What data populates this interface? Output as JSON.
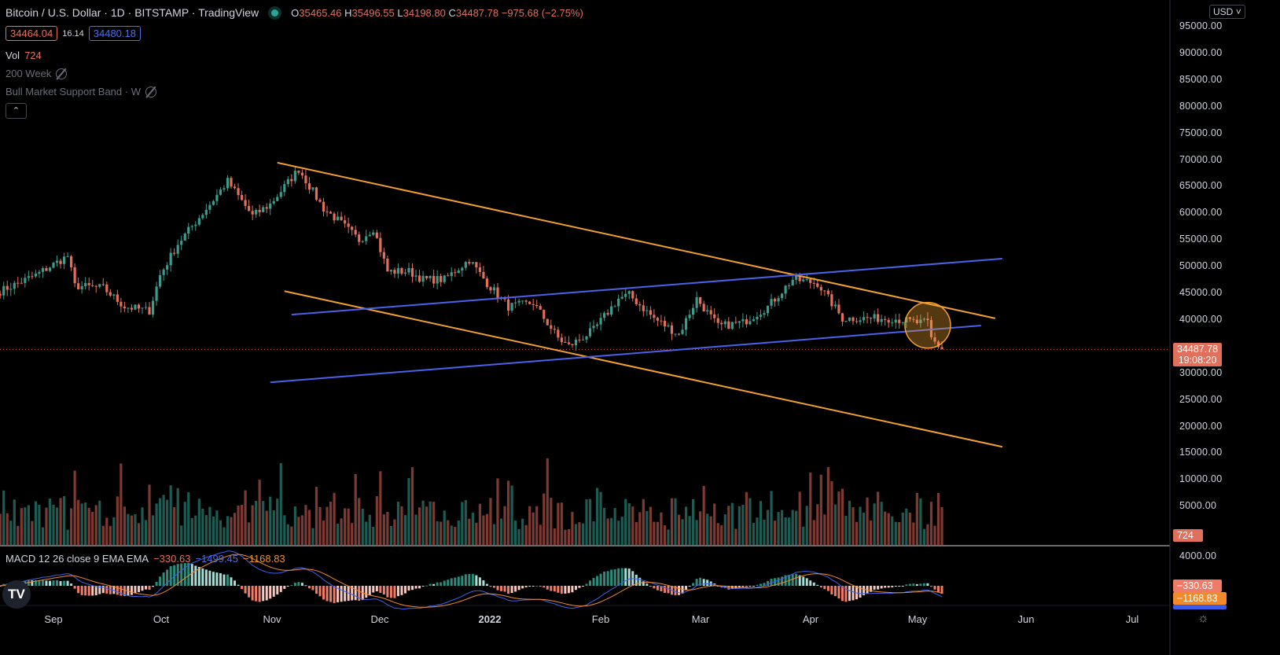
{
  "header": {
    "symbol": "Bitcoin / U.S. Dollar",
    "interval": "1D",
    "exchange": "BITSTAMP",
    "source": "TradingView",
    "market_status_color": "#26a69a",
    "o_label": "O",
    "open": "35465.46",
    "h_label": "H",
    "high": "35496.55",
    "l_label": "L",
    "low": "34198.80",
    "c_label": "C",
    "close": "34487.78",
    "change": "−975.68 (−2.75%)",
    "bid": "34464.04",
    "spread": "16.14",
    "ask": "34480.18"
  },
  "indicators": {
    "vol_label": "Vol",
    "vol_value": "724",
    "ma200": "200 Week",
    "bmsb": "Bull Market Support Band · W",
    "collapse_icon": "chevron-up-icon",
    "hidden_icon": "eye-off-icon"
  },
  "macd": {
    "label": "MACD 12 26 close 9 EMA EMA",
    "hist": "−330.63",
    "macd": "−1499.45",
    "signal": "−1168.83"
  },
  "currency": "USD",
  "price_axis": [
    "95000.00",
    "90000.00",
    "85000.00",
    "80000.00",
    "75000.00",
    "70000.00",
    "65000.00",
    "60000.00",
    "55000.00",
    "50000.00",
    "45000.00",
    "40000.00",
    "30000.00",
    "25000.00",
    "20000.00",
    "15000.00",
    "10000.00",
    "5000.00"
  ],
  "last_price": {
    "price": "34487.78",
    "countdown": "19:08:20",
    "vol": "724"
  },
  "macd_axis": {
    "tick": "4000.00",
    "hist": "−330.63",
    "signal": "−1168.83",
    "macd": "−1499.45"
  },
  "time_axis": [
    "Sep",
    "Oct",
    "Nov",
    "Dec",
    "2022",
    "Feb",
    "Mar",
    "Apr",
    "May",
    "Jun",
    "Jul"
  ],
  "colors": {
    "up": "#3b9c8c",
    "down": "#e0705c",
    "vol_up": "#1e5b52",
    "vol_down": "#7c3a32",
    "orange_line": "#f0a030",
    "blue_line": "#4a62e8",
    "circle": "#f0a030"
  },
  "chart_data": {
    "type": "candlestick",
    "symbol": "BTCUSD",
    "interval": "1D",
    "ylim": [
      0,
      97000
    ],
    "approx_closes": [
      [
        "2021-08-17",
        45400
      ],
      [
        "2021-08-27",
        48400
      ],
      [
        "2021-09-05",
        52000
      ],
      [
        "2021-09-07",
        46400
      ],
      [
        "2021-09-15",
        46000
      ],
      [
        "2021-09-21",
        42500
      ],
      [
        "2021-09-28",
        41700
      ],
      [
        "2021-10-01",
        48400
      ],
      [
        "2021-10-06",
        54300
      ],
      [
        "2021-10-15",
        61700
      ],
      [
        "2021-10-20",
        66000
      ],
      [
        "2021-10-27",
        59500
      ],
      [
        "2021-11-01",
        61700
      ],
      [
        "2021-11-09",
        68300
      ],
      [
        "2021-11-16",
        60900
      ],
      [
        "2021-11-20",
        58700
      ],
      [
        "2021-11-26",
        55000
      ],
      [
        "2021-11-30",
        57200
      ],
      [
        "2021-12-04",
        49100
      ],
      [
        "2021-12-10",
        49100
      ],
      [
        "2021-12-14",
        47600
      ],
      [
        "2021-12-20",
        47600
      ],
      [
        "2021-12-27",
        51300
      ],
      [
        "2022-01-01",
        46900
      ],
      [
        "2022-01-07",
        42500
      ],
      [
        "2022-01-14",
        43200
      ],
      [
        "2022-01-21",
        36600
      ],
      [
        "2022-01-24",
        35100
      ],
      [
        "2022-01-31",
        38100
      ],
      [
        "2022-02-07",
        44000
      ],
      [
        "2022-02-10",
        44700
      ],
      [
        "2022-02-17",
        40300
      ],
      [
        "2022-02-24",
        37300
      ],
      [
        "2022-03-01",
        44000
      ],
      [
        "2022-03-07",
        38800
      ],
      [
        "2022-03-14",
        39500
      ],
      [
        "2022-03-21",
        42500
      ],
      [
        "2022-03-28",
        47600
      ],
      [
        "2022-04-04",
        46900
      ],
      [
        "2022-04-11",
        40300
      ],
      [
        "2022-04-18",
        40300
      ],
      [
        "2022-04-25",
        40300
      ],
      [
        "2022-05-02",
        39500
      ],
      [
        "2022-05-05",
        39500
      ],
      [
        "2022-05-06",
        36500
      ],
      [
        "2022-05-09",
        34487.78
      ]
    ],
    "trendlines": [
      {
        "color": "orange",
        "from": [
          "2021-11-03",
          69500
        ],
        "to": [
          "2022-05-24",
          40300
        ]
      },
      {
        "color": "orange",
        "from": [
          "2021-11-05",
          45400
        ],
        "to": [
          "2022-05-26",
          16200
        ]
      },
      {
        "color": "blue",
        "from": [
          "2021-11-07",
          41000
        ],
        "to": [
          "2022-05-26",
          51500
        ]
      },
      {
        "color": "blue",
        "from": [
          "2021-11-01",
          28300
        ],
        "to": [
          "2022-05-20",
          38950
        ]
      }
    ],
    "highlight_circle": {
      "date": "2022-05-05",
      "price": 39000
    }
  }
}
